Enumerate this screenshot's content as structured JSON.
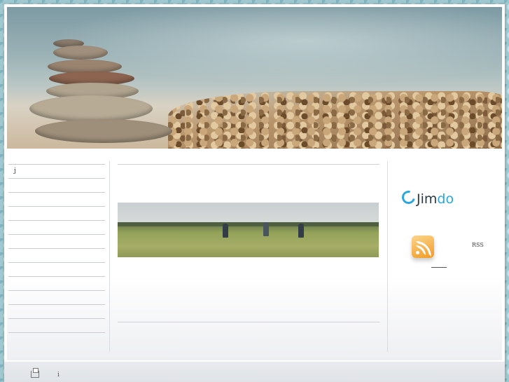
{
  "sidebar": {
    "items": [
      {
        "label": "j"
      },
      {
        "label": ""
      },
      {
        "label": ""
      },
      {
        "label": ""
      },
      {
        "label": ""
      },
      {
        "label": ""
      },
      {
        "label": ""
      },
      {
        "label": ""
      },
      {
        "label": ""
      },
      {
        "label": ""
      },
      {
        "label": ""
      },
      {
        "label": ""
      }
    ]
  },
  "right": {
    "jimdo_left": "Jim",
    "jimdo_right": "do",
    "rss_label": "RSS"
  },
  "footer": {
    "separator": "i"
  },
  "colors": {
    "jimdo_blue": "#2aa7de",
    "rss_orange": "#f29a24"
  }
}
